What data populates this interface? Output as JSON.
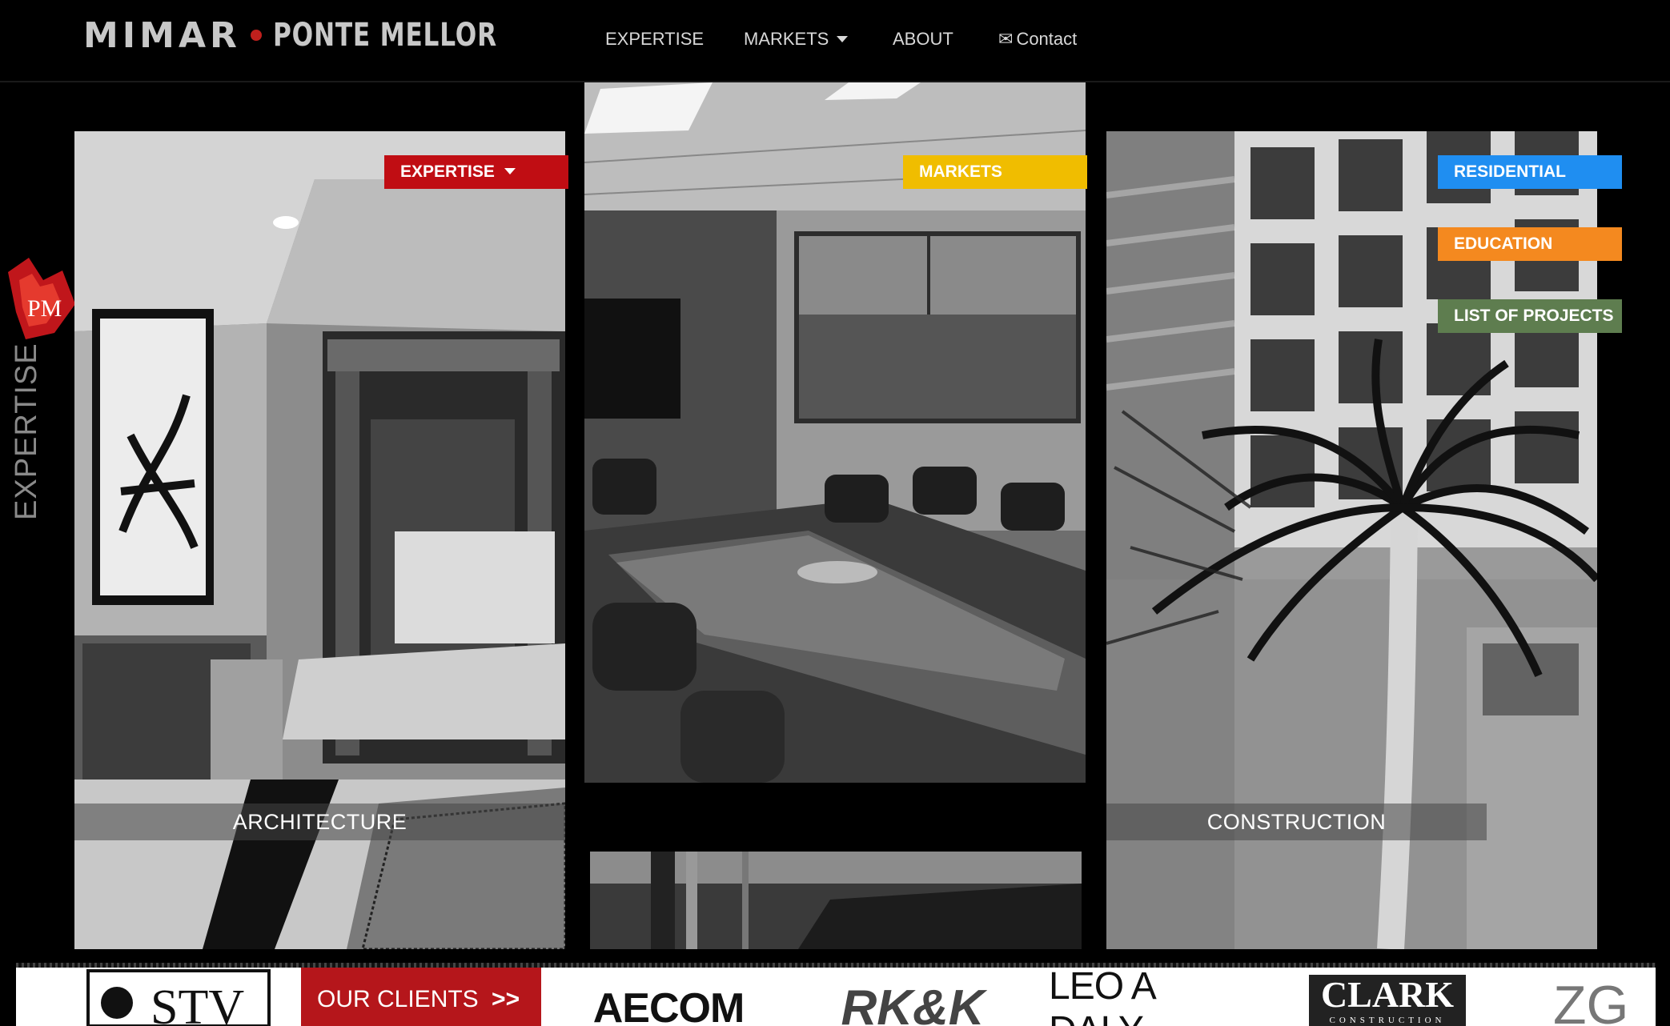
{
  "header": {
    "logo_primary": "MIMAR",
    "logo_secondary": "PONTE MELLOR"
  },
  "nav": {
    "expertise": "EXPERTISE",
    "markets": "MARKETS",
    "about": "ABOUT",
    "contact_icon": "✉",
    "contact": "Contact"
  },
  "side": {
    "badge": "PM",
    "label": "EXPERTISE"
  },
  "panels": {
    "architecture": "ARCHITECTURE",
    "construction": "CONSTRUCTION"
  },
  "tags": {
    "expertise": "EXPERTISE",
    "markets": "MARKETS",
    "residential": "RESIDENTIAL",
    "education": "EDUCATION",
    "projects": "LIST OF PROJECTS"
  },
  "colors": {
    "expertise": "#c00d13",
    "markets": "#f0bd00",
    "residential": "#1f8ef1",
    "education": "#f4891f",
    "projects": "#5e7d4f"
  },
  "clients": {
    "button": "OUR CLIENTS",
    "button_arrows": ">>",
    "logos": [
      "STV",
      "AECOM",
      "RK&K",
      "LEO A DALY",
      "CLARK",
      "CONSTRUCTION",
      "ZG"
    ]
  }
}
